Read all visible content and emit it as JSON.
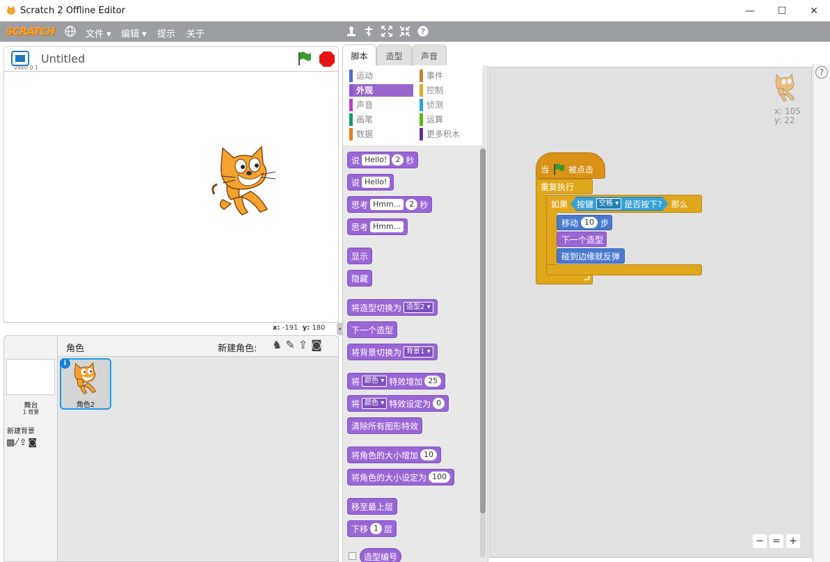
{
  "window": {
    "title": "Scratch 2 Offline Editor",
    "minimize": "—",
    "maximize": "☐",
    "close": "✕"
  },
  "menubar": {
    "logo": "SCRATCH",
    "file": "文件",
    "edit": "编辑",
    "tips": "提示",
    "about": "关于",
    "tool_icons": [
      "duplicate-icon",
      "cut-icon",
      "grow-icon",
      "shrink-icon",
      "help-icon"
    ]
  },
  "stage": {
    "title": "Untitled",
    "version": "v460.0.1",
    "x_label": "x:",
    "x_value": "-191",
    "y_label": "y:",
    "y_value": "180"
  },
  "sprites": {
    "header": "角色",
    "new_sprite_label": "新建角色:",
    "stage_name": "舞台",
    "stage_backdrops": "1 背景",
    "new_backdrop": "新建背景",
    "sprite_name": "角色2"
  },
  "tabs": [
    "脚本",
    "造型",
    "声音"
  ],
  "categories": [
    {
      "label": "运动",
      "color": "#4a6cd4"
    },
    {
      "label": "事件",
      "color": "#c88330"
    },
    {
      "label": "外观",
      "color": "#8a55d7"
    },
    {
      "label": "控制",
      "color": "#e1a91a"
    },
    {
      "label": "声音",
      "color": "#bb42c3"
    },
    {
      "label": "侦测",
      "color": "#2ca5e2"
    },
    {
      "label": "画笔",
      "color": "#0e9a6c"
    },
    {
      "label": "运算",
      "color": "#5cb712"
    },
    {
      "label": "数据",
      "color": "#ee7d16"
    },
    {
      "label": "更多积木",
      "color": "#632d99"
    }
  ],
  "palette_blocks": {
    "say_secs": {
      "t1": "说",
      "input": "Hello!",
      "num": "2",
      "t2": "秒"
    },
    "say": {
      "t1": "说",
      "input": "Hello!"
    },
    "think_secs": {
      "t1": "思考",
      "input": "Hmm...",
      "num": "2",
      "t2": "秒"
    },
    "think": {
      "t1": "思考",
      "input": "Hmm..."
    },
    "show": "显示",
    "hide": "隐藏",
    "switch_costume": {
      "t1": "将造型切换为",
      "dd": "造型2"
    },
    "next_costume": "下一个造型",
    "switch_backdrop": {
      "t1": "将背景切换为",
      "dd": "背景1"
    },
    "change_effect": {
      "t1": "将",
      "dd": "颜色",
      "t2": "特效增加",
      "num": "25"
    },
    "set_effect": {
      "t1": "将",
      "dd": "颜色",
      "t2": "特效设定为",
      "num": "0"
    },
    "clear_effects": "清除所有图形特效",
    "change_size": {
      "t1": "将角色的大小增加",
      "num": "10"
    },
    "set_size": {
      "t1": "将角色的大小设定为",
      "num": "100"
    },
    "front": "移至最上层",
    "back": {
      "t1": "下移",
      "num": "1",
      "t2": "层"
    },
    "costume_num": "造型编号"
  },
  "script": {
    "hat_t1": "当",
    "hat_t2": "被点击",
    "forever": "重复执行",
    "if_t1": "如果",
    "key_t1": "按键",
    "key_dd": "空格",
    "key_t2": "是否按下?",
    "if_t2": "那么",
    "move_t1": "移动",
    "move_num": "10",
    "move_t2": "步",
    "next_costume": "下一个造型",
    "bounce": "碰到边缘就反弹"
  },
  "sprite_info": {
    "x": "x: 105",
    "y": "y: 22"
  },
  "zoom": {
    "out": "−",
    "reset": "=",
    "in": "+"
  },
  "colors": {
    "menubar": "#9c9ea2",
    "looks": "#9a66d6",
    "control": "#e0a71d",
    "motion": "#4a7ad0",
    "events": "#d99118",
    "sensing": "#36a0d9"
  }
}
